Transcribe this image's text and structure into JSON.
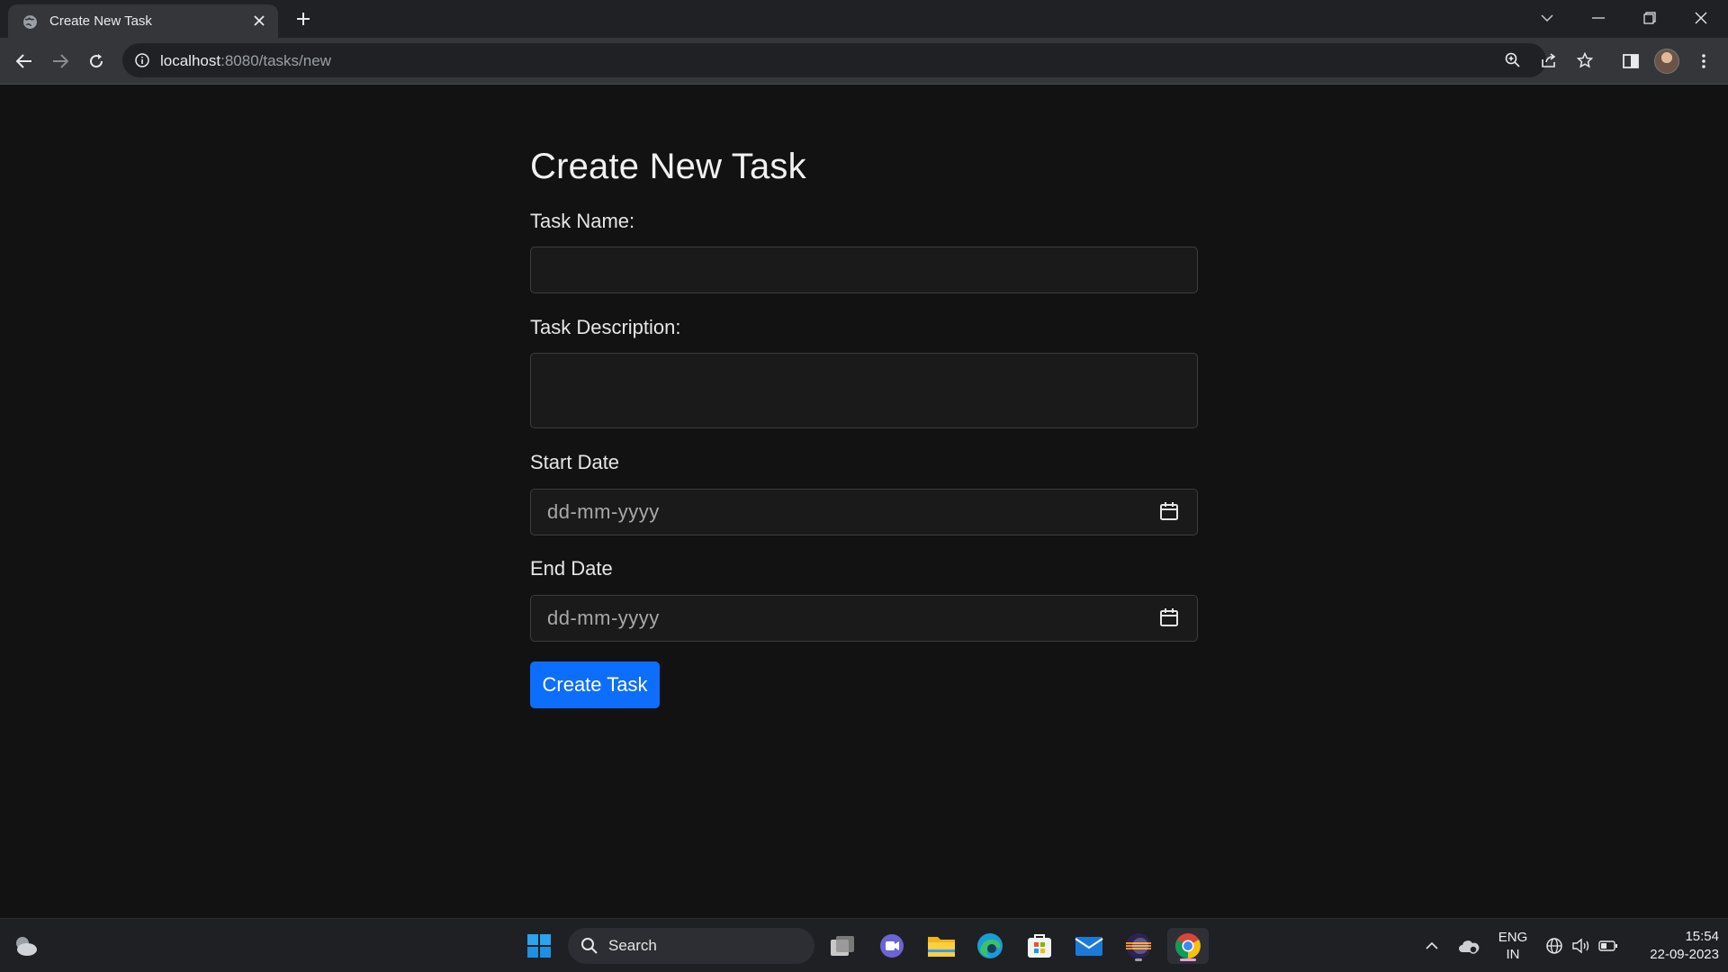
{
  "browser": {
    "tab_title": "Create New Task",
    "url_host": "localhost",
    "url_path": ":8080/tasks/new"
  },
  "page": {
    "heading": "Create New Task",
    "task_name_label": "Task Name:",
    "task_name_value": "",
    "task_description_label": "Task Description:",
    "task_description_value": "",
    "start_date_label": "Start Date",
    "start_date_placeholder": "dd-mm-yyyy",
    "end_date_label": "End Date",
    "end_date_placeholder": "dd-mm-yyyy",
    "submit_label": "Create Task",
    "accent_color": "#0d6efd"
  },
  "taskbar": {
    "search_label": "Search",
    "lang_line1": "ENG",
    "lang_line2": "IN",
    "time": "15:54",
    "date": "22-09-2023"
  }
}
